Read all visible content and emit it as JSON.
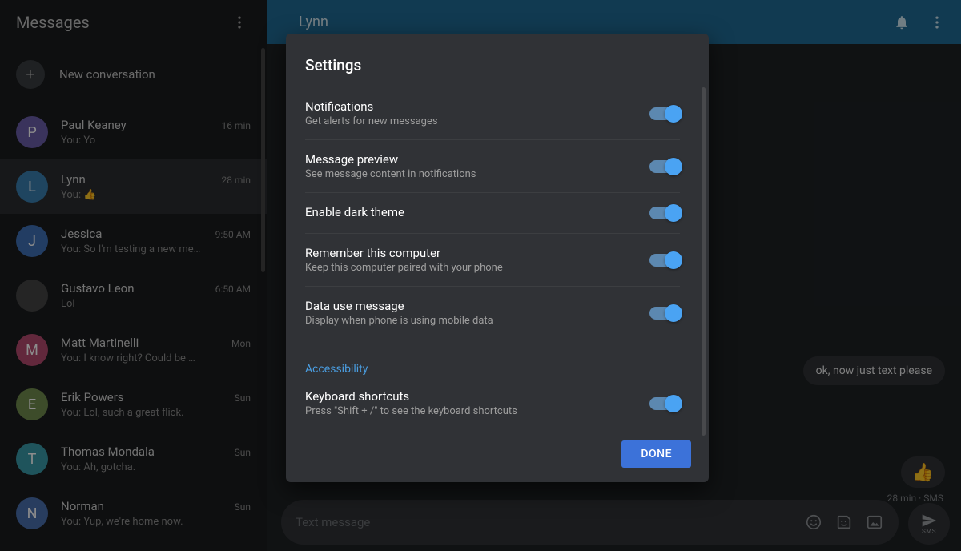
{
  "sidebar": {
    "title": "Messages",
    "new_conversation": "New conversation"
  },
  "conversations": [
    {
      "initial": "P",
      "color": "#6a5da8",
      "name": "Paul Keaney",
      "time": "16 min",
      "preview": "You: Yo"
    },
    {
      "initial": "L",
      "color": "#3a7fb0",
      "name": "Lynn",
      "time": "28 min",
      "preview": "You: 👍",
      "selected": true
    },
    {
      "initial": "J",
      "color": "#3f6fb5",
      "name": "Jessica",
      "time": "9:50 AM",
      "preview": "You: So I'm testing a new me…"
    },
    {
      "initial": "",
      "color": "#444",
      "name": "Gustavo Leon",
      "time": "6:50 AM",
      "preview": "Lol",
      "avatar_img": true
    },
    {
      "initial": "M",
      "color": "#b24a6d",
      "name": "Matt Martinelli",
      "time": "Mon",
      "preview": "You: I know right? Could be …"
    },
    {
      "initial": "E",
      "color": "#6f8a4d",
      "name": "Erik Powers",
      "time": "Sun",
      "preview": "You: Lol, such a great flick."
    },
    {
      "initial": "T",
      "color": "#3a9aa8",
      "name": "Thomas Mondala",
      "time": "Sun",
      "preview": "You: Ah, gotcha."
    },
    {
      "initial": "N",
      "color": "#4a6fae",
      "name": "Norman",
      "time": "Sun",
      "preview": "You: Yup, we're home now."
    }
  ],
  "chat": {
    "header_name": "Lynn",
    "message_text": "ok, now just text please",
    "thumb": "👍",
    "meta": "28 min · SMS",
    "composer_placeholder": "Text message",
    "send_label": "SMS"
  },
  "settings": {
    "title": "Settings",
    "accessibility_label": "Accessibility",
    "done_label": "DONE",
    "items": [
      {
        "title": "Notifications",
        "sub": "Get alerts for new messages",
        "on": true
      },
      {
        "title": "Message preview",
        "sub": "See message content in notifications",
        "on": true
      },
      {
        "title": "Enable dark theme",
        "sub": "",
        "on": true
      },
      {
        "title": "Remember this computer",
        "sub": "Keep this computer paired with your phone",
        "on": true
      },
      {
        "title": "Data use message",
        "sub": "Display when phone is using mobile data",
        "on": true
      }
    ],
    "a11y_items": [
      {
        "title": "Keyboard shortcuts",
        "sub": "Press \"Shift + /\" to see the keyboard shortcuts",
        "on": true
      }
    ]
  }
}
